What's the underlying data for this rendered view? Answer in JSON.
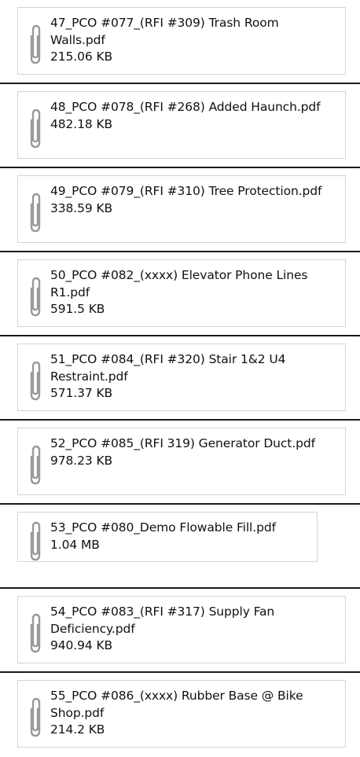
{
  "attachments": [
    {
      "name": "47_PCO #077_(RFI #309) Trash Room Walls.pdf",
      "size": "215.06 KB"
    },
    {
      "name": "48_PCO #078_(RFI #268) Added Haunch.pdf",
      "size": "482.18 KB"
    },
    {
      "name": "49_PCO #079_(RFI #310) Tree Protection.pdf",
      "size": "338.59 KB"
    },
    {
      "name": "50_PCO #082_(xxxx) Elevator Phone Lines R1.pdf",
      "size": "591.5 KB"
    },
    {
      "name": "51_PCO #084_(RFI #320) Stair 1&2 U4 Restraint.pdf",
      "size": "571.37 KB"
    },
    {
      "name": "52_PCO #085_(RFI 319) Generator Duct.pdf",
      "size": "978.23 KB"
    },
    {
      "name": "53_PCO #080_Demo Flowable Fill.pdf",
      "size": "1.04 MB"
    },
    {
      "name": "54_PCO #083_(RFI #317) Supply Fan Deficiency.pdf",
      "size": "940.94 KB"
    },
    {
      "name": "55_PCO #086_(xxxx) Rubber Base @ Bike Shop.pdf",
      "size": "214.2 KB"
    }
  ],
  "icons": {
    "attachment": "paperclip-icon"
  }
}
